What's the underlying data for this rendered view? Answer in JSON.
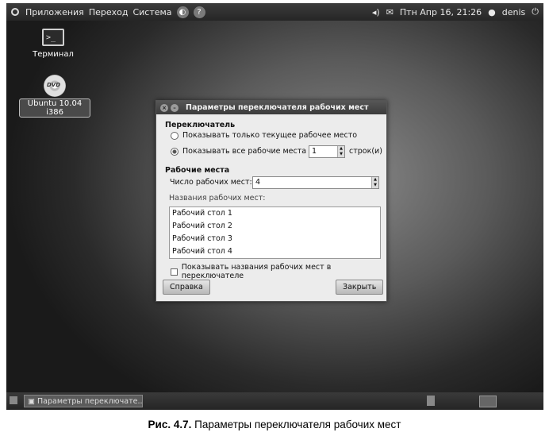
{
  "top_panel": {
    "menus": [
      "Приложения",
      "Переход",
      "Система"
    ],
    "clock": "Птн Апр 16, 21:26",
    "user": "denis"
  },
  "desktop": {
    "terminal_label": "Терминал",
    "dvd_label": "Ubuntu 10.04 i386",
    "dvd_badge": "DVD"
  },
  "dialog": {
    "title": "Параметры переключателя рабочих мест",
    "switcher_heading": "Переключатель",
    "radio_current": "Показывать только текущее рабочее место",
    "radio_all": "Показывать все рабочие места в",
    "rows_value": "1",
    "rows_suffix": "строк(и)",
    "workspaces_heading": "Рабочие места",
    "count_label": "Число рабочих мест:",
    "count_value": "4",
    "names_label": "Названия рабочих мест:",
    "workspace_names": [
      "Рабочий стол 1",
      "Рабочий стол 2",
      "Рабочий стол 3",
      "Рабочий стол 4"
    ],
    "show_names_label": "Показывать названия рабочих мест в переключателе",
    "help_button": "Справка",
    "close_button": "Закрыть"
  },
  "bottom_panel": {
    "task_label": "Параметры переключате..."
  },
  "caption": {
    "prefix": "Рис. 4.7.",
    "text": " Параметры переключателя рабочих мест"
  }
}
